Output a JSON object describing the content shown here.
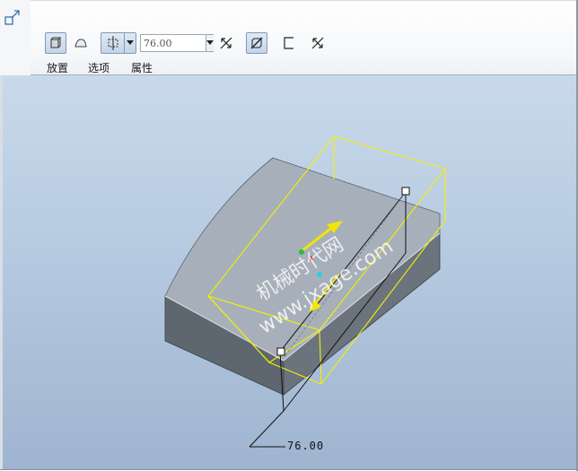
{
  "toolbar": {
    "depth_value": "76.00",
    "tabs": [
      {
        "label": "放置"
      },
      {
        "label": "选项"
      },
      {
        "label": "属性"
      }
    ]
  },
  "viewport": {
    "watermark_cn": "机械时代网",
    "watermark_url": "www.jxage.com",
    "dimension_label": "76.00"
  },
  "icons": {
    "corner": "resize-corner-icon",
    "solid": "solid-extrude-icon",
    "surface": "surface-extrude-icon",
    "depth_mode": "blind-depth-icon",
    "flip": "flip-direction-icon",
    "remove": "remove-material-icon",
    "thicken": "thicken-sketch-icon",
    "flip2": "flip-thicken-icon"
  },
  "colors": {
    "preview": "#f2f200",
    "viewport_top": "#c9d9ea",
    "viewport_bottom": "#9fb4cf"
  }
}
